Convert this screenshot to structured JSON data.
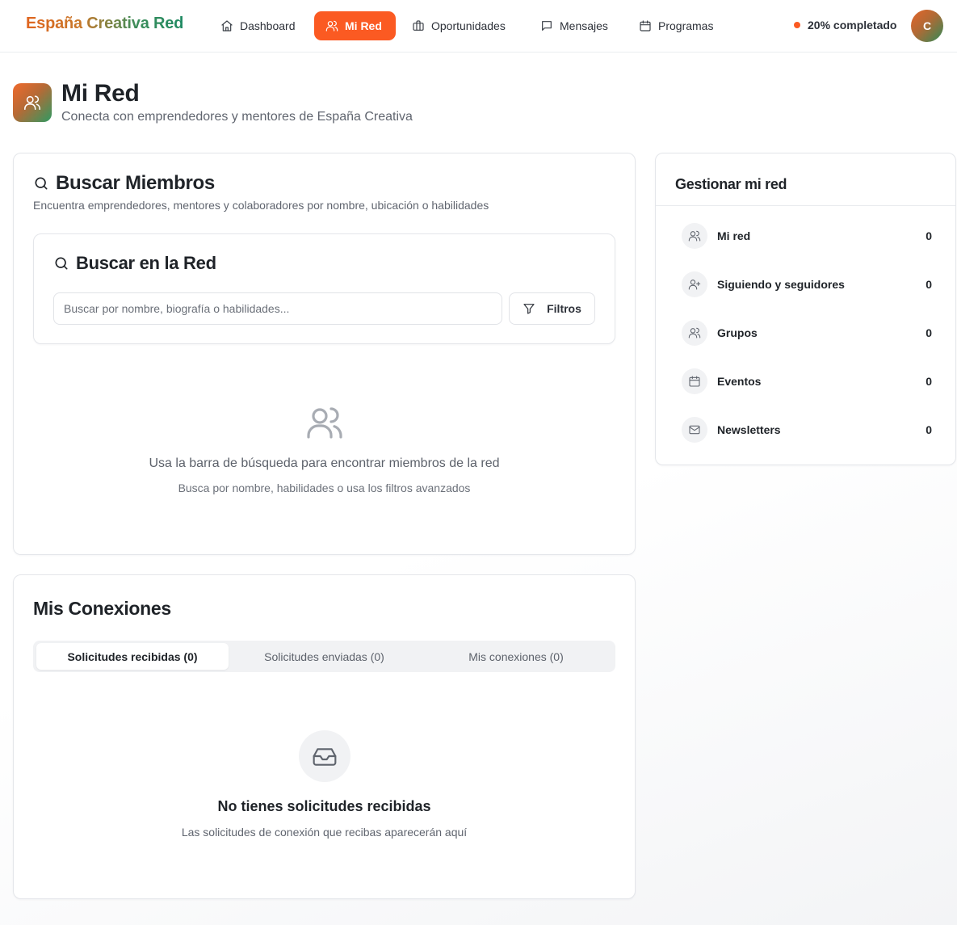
{
  "brand": "España Creativa Red",
  "nav": [
    {
      "label": "Dashboard",
      "icon": "home-icon"
    },
    {
      "label": "Mi Red",
      "icon": "users-icon",
      "active": true
    },
    {
      "label": "Oportunidades",
      "icon": "briefcase-icon"
    },
    {
      "label": "Mensajes",
      "icon": "message-icon"
    },
    {
      "label": "Programas",
      "icon": "calendar-icon"
    }
  ],
  "profile": {
    "progress_label": "20% completado",
    "avatar_initial": "C"
  },
  "header": {
    "title": "Mi Red",
    "subtitle": "Conecta con emprendedores y mentores de España Creativa"
  },
  "search_card": {
    "title": "Buscar Miembros",
    "description": "Encuentra emprendedores, mentores y colaboradores por nombre, ubicación o habilidades",
    "inner_title": "Buscar en la Red",
    "input_placeholder": "Buscar por nombre, biografía o habilidades...",
    "filter_label": "Filtros",
    "empty_title": "Usa la barra de búsqueda para encontrar miembros de la red",
    "empty_subtitle": "Busca por nombre, habilidades o usa los filtros avanzados"
  },
  "connections_card": {
    "title": "Mis Conexiones",
    "tabs": [
      {
        "label": "Solicitudes recibidas (0)",
        "active": true
      },
      {
        "label": "Solicitudes enviadas (0)"
      },
      {
        "label": "Mis conexiones (0)"
      }
    ],
    "empty_title": "No tienes solicitudes recibidas",
    "empty_subtitle": "Las solicitudes de conexión que recibas aparecerán aquí"
  },
  "manage_card": {
    "title": "Gestionar mi red",
    "items": [
      {
        "label": "Mi red",
        "count": "0",
        "icon": "users-icon"
      },
      {
        "label": "Siguiendo y seguidores",
        "count": "0",
        "icon": "user-plus-icon"
      },
      {
        "label": "Grupos",
        "count": "0",
        "icon": "users-icon"
      },
      {
        "label": "Eventos",
        "count": "0",
        "icon": "calendar-icon"
      },
      {
        "label": "Newsletters",
        "count": "0",
        "icon": "mail-icon"
      }
    ]
  },
  "colors": {
    "accent": "#fb5a22",
    "brand_green": "#1f8a63"
  }
}
